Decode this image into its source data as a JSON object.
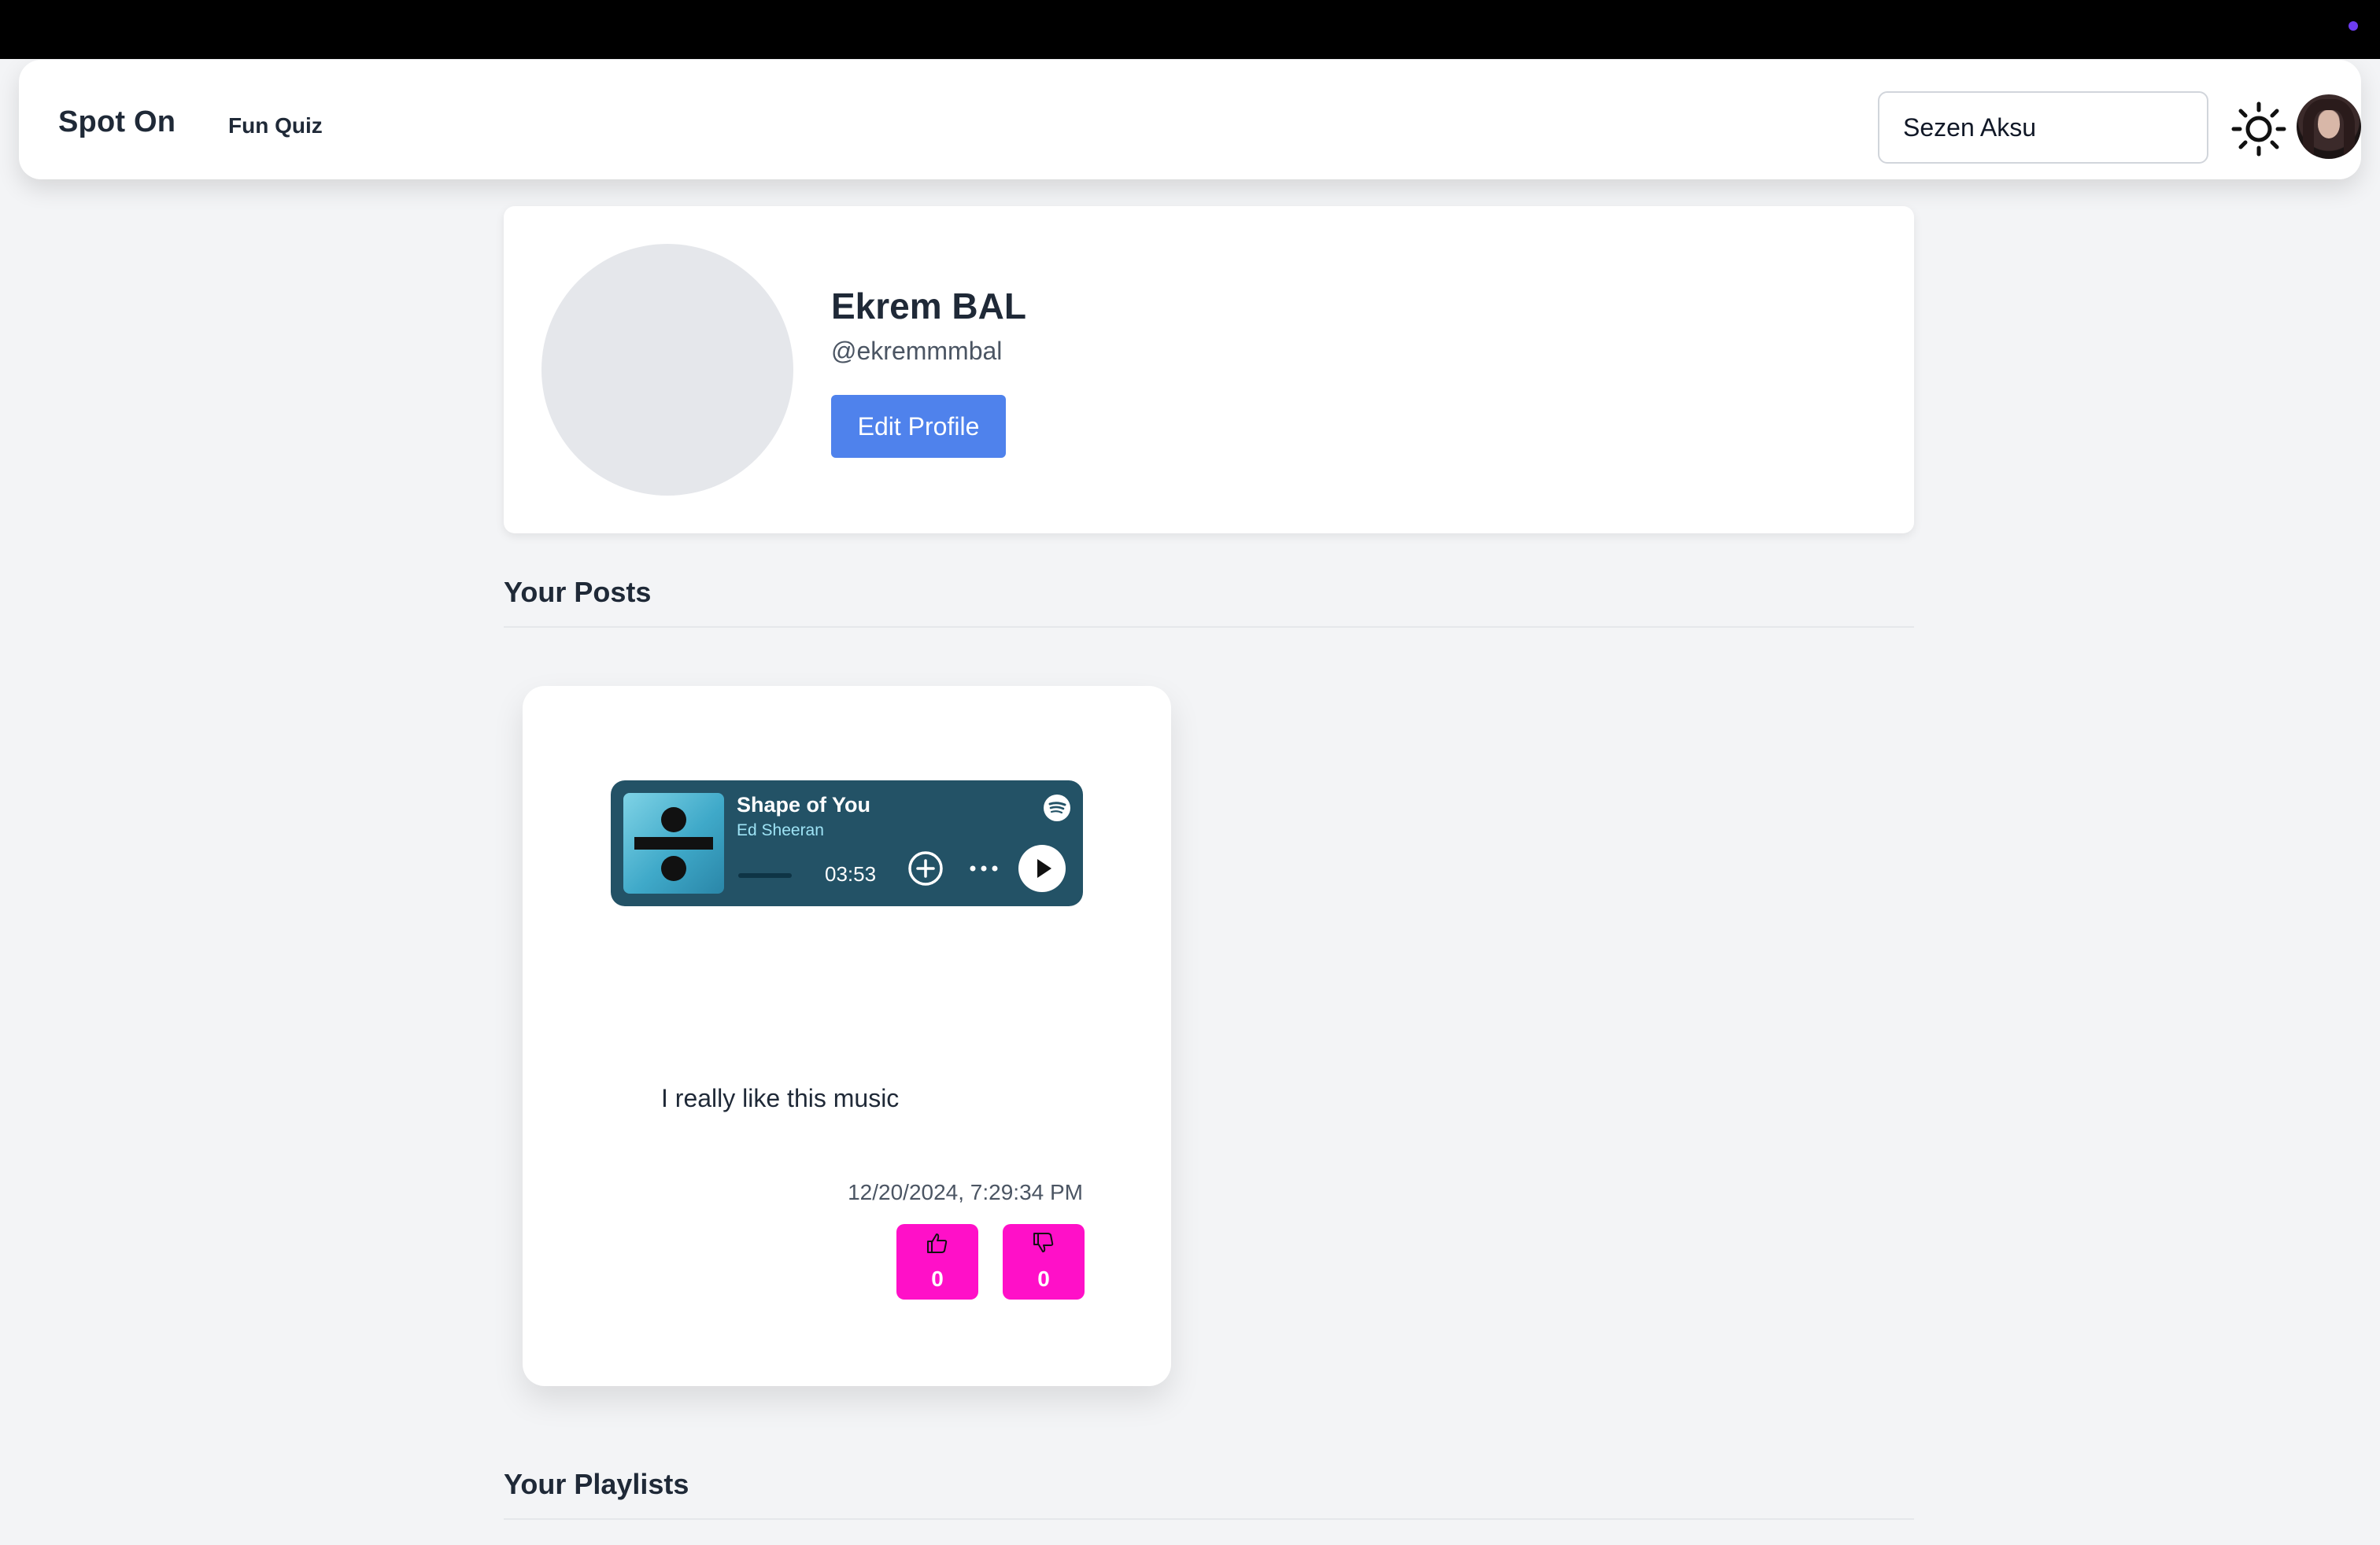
{
  "colors": {
    "accent": "#4f82ec",
    "vote": "#ff10c8",
    "player_bg": "#235266",
    "status_dot": "#6d3cf0"
  },
  "navbar": {
    "brand": "Spot On",
    "links": [
      "Fun Quiz"
    ],
    "search_value": "Sezen Aksu",
    "theme_icon": "sun-icon",
    "avatar_icon": "avatar"
  },
  "profile": {
    "name": "Ekrem BAL",
    "handle": "@ekremmmbal",
    "edit_label": "Edit Profile"
  },
  "sections": {
    "posts_title": "Your Posts",
    "playlists_title": "Your Playlists"
  },
  "posts": [
    {
      "track": {
        "title": "Shape of You",
        "artist": "Ed Sheeran",
        "duration": "03:53"
      },
      "text": "I really like this music",
      "date": "12/20/2024, 7:29:34 PM",
      "likes": "0",
      "dislikes": "0"
    }
  ]
}
